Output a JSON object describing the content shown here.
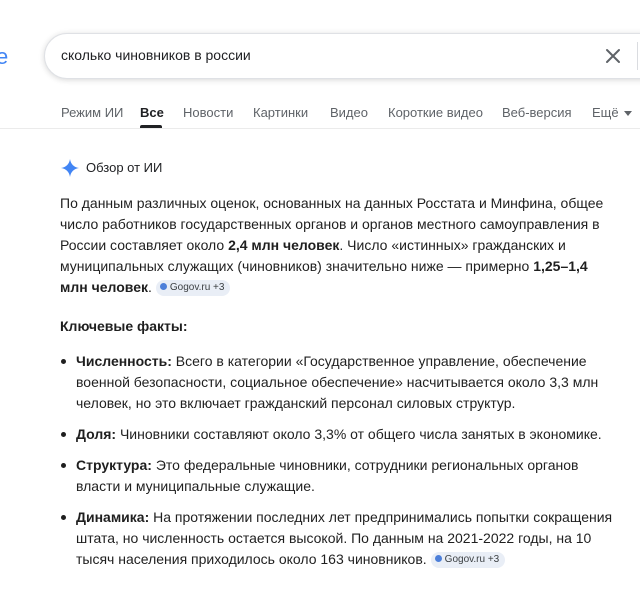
{
  "search": {
    "query": "сколько чиновников в россии",
    "logo_fragment": "e"
  },
  "tabs": [
    {
      "label": "Режим ИИ"
    },
    {
      "label": "Все"
    },
    {
      "label": "Новости"
    },
    {
      "label": "Картинки"
    },
    {
      "label": "Видео"
    },
    {
      "label": "Короткие видео"
    },
    {
      "label": "Веб-версия"
    },
    {
      "label": "Ещё"
    }
  ],
  "overview": {
    "label": "Обзор от ИИ",
    "intro": {
      "part1": "По данным различных оценок, основанных на данных Росстата и Минфина, общее число работников государственных органов и органов местного самоуправления в России составляет около ",
      "bold1": "2,4 млн человек",
      "part2": ". Число «истинных» гражданских и муниципальных служащих (чиновников) значительно ниже — примерно ",
      "bold2": "1,25–1,4 млн человек",
      "part3": ".",
      "source": "Gogov.ru +3"
    },
    "key_facts_title": "Ключевые факты:",
    "facts": [
      {
        "title": "Численность:",
        "text": " Всего в категории «Государственное управление, обеспечение военной безопасности, социальное обеспечение» насчитывается около 3,3 млн человек, но это включает гражданский персонал силовых структур."
      },
      {
        "title": "Доля:",
        "text": " Чиновники составляют около 3,3% от общего числа занятых в экономике."
      },
      {
        "title": "Структура:",
        "text": " Это федеральные чиновники, сотрудники региональных органов власти и муниципальные служащие."
      },
      {
        "title": "Динамика:",
        "text": " На протяжении последних лет предпринимались попытки сокращения штата, но численность остается высокой. По данным на 2021-2022 годы, на 10 тысяч населения приходилось около 163 чиновников.",
        "source": "Gogov.ru +3"
      }
    ]
  },
  "colors": {
    "accent": "#4285f4",
    "text": "#1f1f1f",
    "muted": "#5f6368",
    "chip_bg": "#e9eef6"
  }
}
